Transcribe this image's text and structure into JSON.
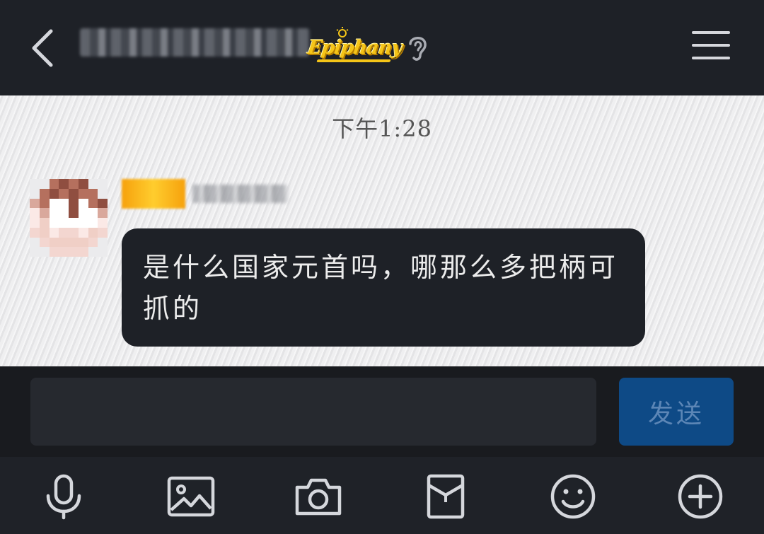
{
  "header": {
    "title": "",
    "badge_text": "Epiphany",
    "colors": {
      "background": "#1e2127",
      "badge": "#f5c518",
      "icons": "#d5d7dc"
    },
    "icons": {
      "back": "chevron-left-icon",
      "ear": "ear-icon",
      "menu": "hamburger-menu-icon"
    }
  },
  "chat": {
    "timestamp": "下午1:28",
    "messages": [
      {
        "sender_name": "",
        "level_badge": "",
        "text": "是什么国家元首吗，哪那么多把柄可抓的"
      }
    ]
  },
  "input": {
    "value": "",
    "placeholder": "",
    "send_label": "发送",
    "send_color": "#0e4a86"
  },
  "toolbar": {
    "items": [
      {
        "icon": "microphone-icon"
      },
      {
        "icon": "image-icon"
      },
      {
        "icon": "camera-icon"
      },
      {
        "icon": "red-packet-icon"
      },
      {
        "icon": "smiley-icon"
      },
      {
        "icon": "plus-circle-icon"
      }
    ]
  }
}
